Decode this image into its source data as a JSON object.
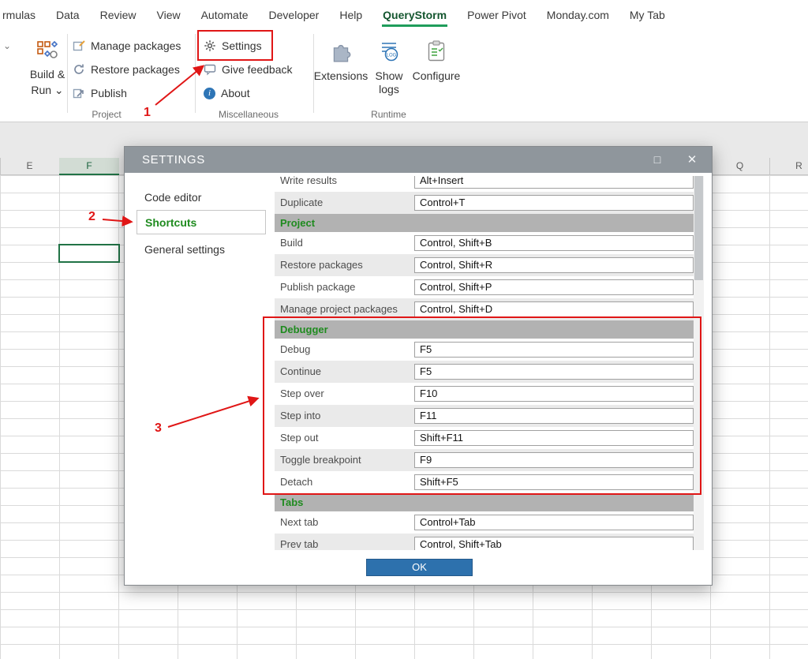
{
  "menubar": {
    "items": [
      "rmulas",
      "Data",
      "Review",
      "View",
      "Automate",
      "Developer",
      "Help",
      "QueryStorm",
      "Power Pivot",
      "Monday.com",
      "My Tab"
    ]
  },
  "ribbon": {
    "build_run_line1": "Build &",
    "build_run_line2": "Run",
    "project": {
      "caption": "Project",
      "items": [
        "Manage packages",
        "Restore packages",
        "Publish"
      ]
    },
    "misc": {
      "caption": "Miscellaneous",
      "items": [
        "Settings",
        "Give feedback",
        "About"
      ]
    },
    "runtime": {
      "caption": "Runtime",
      "items": [
        "Extensions",
        "Show logs",
        "Configure"
      ]
    }
  },
  "sheet": {
    "left_columns": [
      "E",
      "F"
    ],
    "right_columns": [
      "Q",
      "R"
    ]
  },
  "dialog": {
    "title": "SETTINGS",
    "nav": [
      "Code editor",
      "Shortcuts",
      "General settings"
    ],
    "ok_label": "OK",
    "shortcuts": [
      {
        "type": "shortcut",
        "label": "Write results",
        "value": "Alt+Insert"
      },
      {
        "type": "shortcut",
        "label": "Duplicate",
        "value": "Control+T"
      },
      {
        "type": "section",
        "label": "Project"
      },
      {
        "type": "shortcut",
        "label": "Build",
        "value": "Control, Shift+B"
      },
      {
        "type": "shortcut",
        "label": "Restore packages",
        "value": "Control, Shift+R"
      },
      {
        "type": "shortcut",
        "label": "Publish package",
        "value": "Control, Shift+P"
      },
      {
        "type": "shortcut",
        "label": "Manage project packages",
        "value": "Control, Shift+D"
      },
      {
        "type": "section",
        "label": "Debugger"
      },
      {
        "type": "shortcut",
        "label": "Debug",
        "value": "F5"
      },
      {
        "type": "shortcut",
        "label": "Continue",
        "value": "F5"
      },
      {
        "type": "shortcut",
        "label": "Step over",
        "value": "F10"
      },
      {
        "type": "shortcut",
        "label": "Step into",
        "value": "F11"
      },
      {
        "type": "shortcut",
        "label": "Step out",
        "value": "Shift+F11"
      },
      {
        "type": "shortcut",
        "label": "Toggle breakpoint",
        "value": "F9"
      },
      {
        "type": "shortcut",
        "label": "Detach",
        "value": "Shift+F5"
      },
      {
        "type": "section",
        "label": "Tabs"
      },
      {
        "type": "shortcut",
        "label": "Next tab",
        "value": "Control+Tab"
      },
      {
        "type": "shortcut",
        "label": "Prev tab",
        "value": "Control, Shift+Tab"
      }
    ]
  },
  "annotations": {
    "step1": "1",
    "step2": "2",
    "step3": "3"
  },
  "icons": {
    "chevron_down": "⌄",
    "maximize": "□",
    "close": "✕",
    "info": "i",
    "log_text": "LOG"
  },
  "colors": {
    "accent_green": "#217346",
    "annotation_red": "#e01616",
    "ok_blue": "#2d71ad",
    "titlebar_gray": "#8f969c"
  }
}
